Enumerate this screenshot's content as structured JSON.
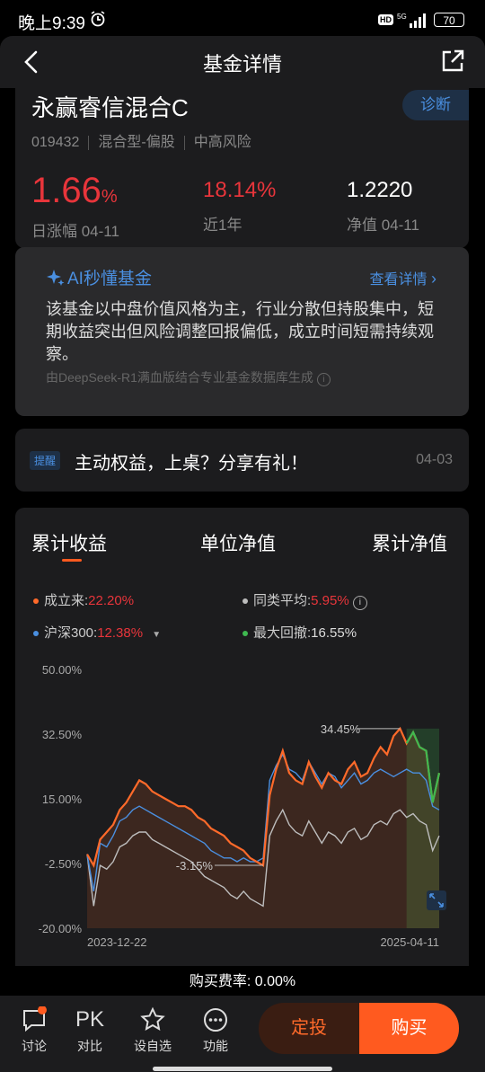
{
  "status": {
    "time": "晚上9:39",
    "battery": "70",
    "hd": "HD"
  },
  "nav": {
    "title": "基金详情"
  },
  "fund": {
    "name": "永赢睿信混合C",
    "code": "019432",
    "type": "混合型-偏股",
    "risk": "中高风险",
    "diagnose": "诊断",
    "daily_change": "1.66",
    "daily_unit": "%",
    "daily_label": "日涨幅 04-11",
    "year_change": "18.14%",
    "year_label": "近1年",
    "nav_value": "1.2220",
    "nav_label": "净值 04-11"
  },
  "ai": {
    "title": "AI秒懂基金",
    "more": "查看详情",
    "body": "该基金以中盘价值风格为主，行业分散但持股集中，短期收益突出但风险调整回报偏低，成立时间短需持续观察。",
    "footer": "由DeepSeek-R1满血版结合专业基金数据库生成"
  },
  "notice": {
    "tag": "提醒",
    "text": "主动权益，上桌？分享有礼！",
    "date": "04-03"
  },
  "tabs": [
    "累计收益",
    "单位净值",
    "累计净值"
  ],
  "legend": {
    "since_label": "成立来:",
    "since_value": "22.20%",
    "peer_label": "同类平均:",
    "peer_value": "5.95%",
    "index_label": "沪深300:",
    "index_value": "12.38%",
    "dd_label": "最大回撤:",
    "dd_value": "16.55%"
  },
  "colors": {
    "fund": "#ff6a2a",
    "peer": "#bdbdbd",
    "index": "#4a8fe0",
    "drawdown": "#3fb950",
    "up": "#e8353b"
  },
  "chart_data": {
    "type": "line",
    "ylim": [
      -20,
      50
    ],
    "yticks": [
      "50.00%",
      "32.50%",
      "15.00%",
      "-2.50%",
      "-20.00%"
    ],
    "x_start": "2023-12-22",
    "x_end": "2025-04-11",
    "annotations": [
      "34.45%",
      "-3.15%"
    ],
    "series": [
      {
        "name": "成立来",
        "values": [
          0,
          -3,
          4,
          6,
          8,
          12,
          14,
          17,
          20,
          19,
          17,
          16,
          15,
          14,
          13,
          13,
          12,
          10,
          9,
          7,
          6,
          5,
          3,
          2,
          1,
          -1,
          -2,
          -3,
          16,
          23,
          28,
          22,
          20,
          19,
          25,
          21,
          18,
          22,
          20,
          19,
          23,
          25,
          21,
          22,
          26,
          29,
          27,
          32,
          34,
          30,
          33,
          29,
          28,
          14,
          22
        ]
      },
      {
        "name": "沪深300",
        "values": [
          0,
          -10,
          3,
          2,
          5,
          9,
          10,
          12,
          13,
          12,
          11,
          10,
          9,
          8,
          7,
          6,
          5,
          4,
          3,
          1,
          0,
          -1,
          -1,
          -2,
          -1,
          -2,
          -2,
          -1,
          20,
          24,
          27,
          23,
          22,
          20,
          25,
          22,
          19,
          22,
          21,
          18,
          20,
          22,
          19,
          20,
          22,
          23,
          22,
          21,
          22,
          23,
          22,
          22,
          20,
          13,
          12
        ]
      },
      {
        "name": "同类平均",
        "values": [
          0,
          -14,
          -3,
          -4,
          -2,
          2,
          3,
          5,
          6,
          6,
          4,
          3,
          2,
          1,
          0,
          -1,
          -2,
          -4,
          -6,
          -7,
          -8,
          -9,
          -11,
          -12,
          -10,
          -12,
          -13,
          -14,
          5,
          9,
          12,
          8,
          6,
          5,
          9,
          6,
          3,
          6,
          5,
          3,
          6,
          7,
          4,
          5,
          8,
          9,
          8,
          11,
          12,
          10,
          11,
          9,
          8,
          1,
          5
        ]
      }
    ],
    "drawdown_value": "16.55%"
  },
  "fee": "购买费率: 0.00%",
  "bottom": {
    "discuss": "讨论",
    "pk": "PK",
    "compare": "对比",
    "watch": "设自选",
    "func": "功能",
    "dingtou": "定投",
    "buy": "购买"
  }
}
